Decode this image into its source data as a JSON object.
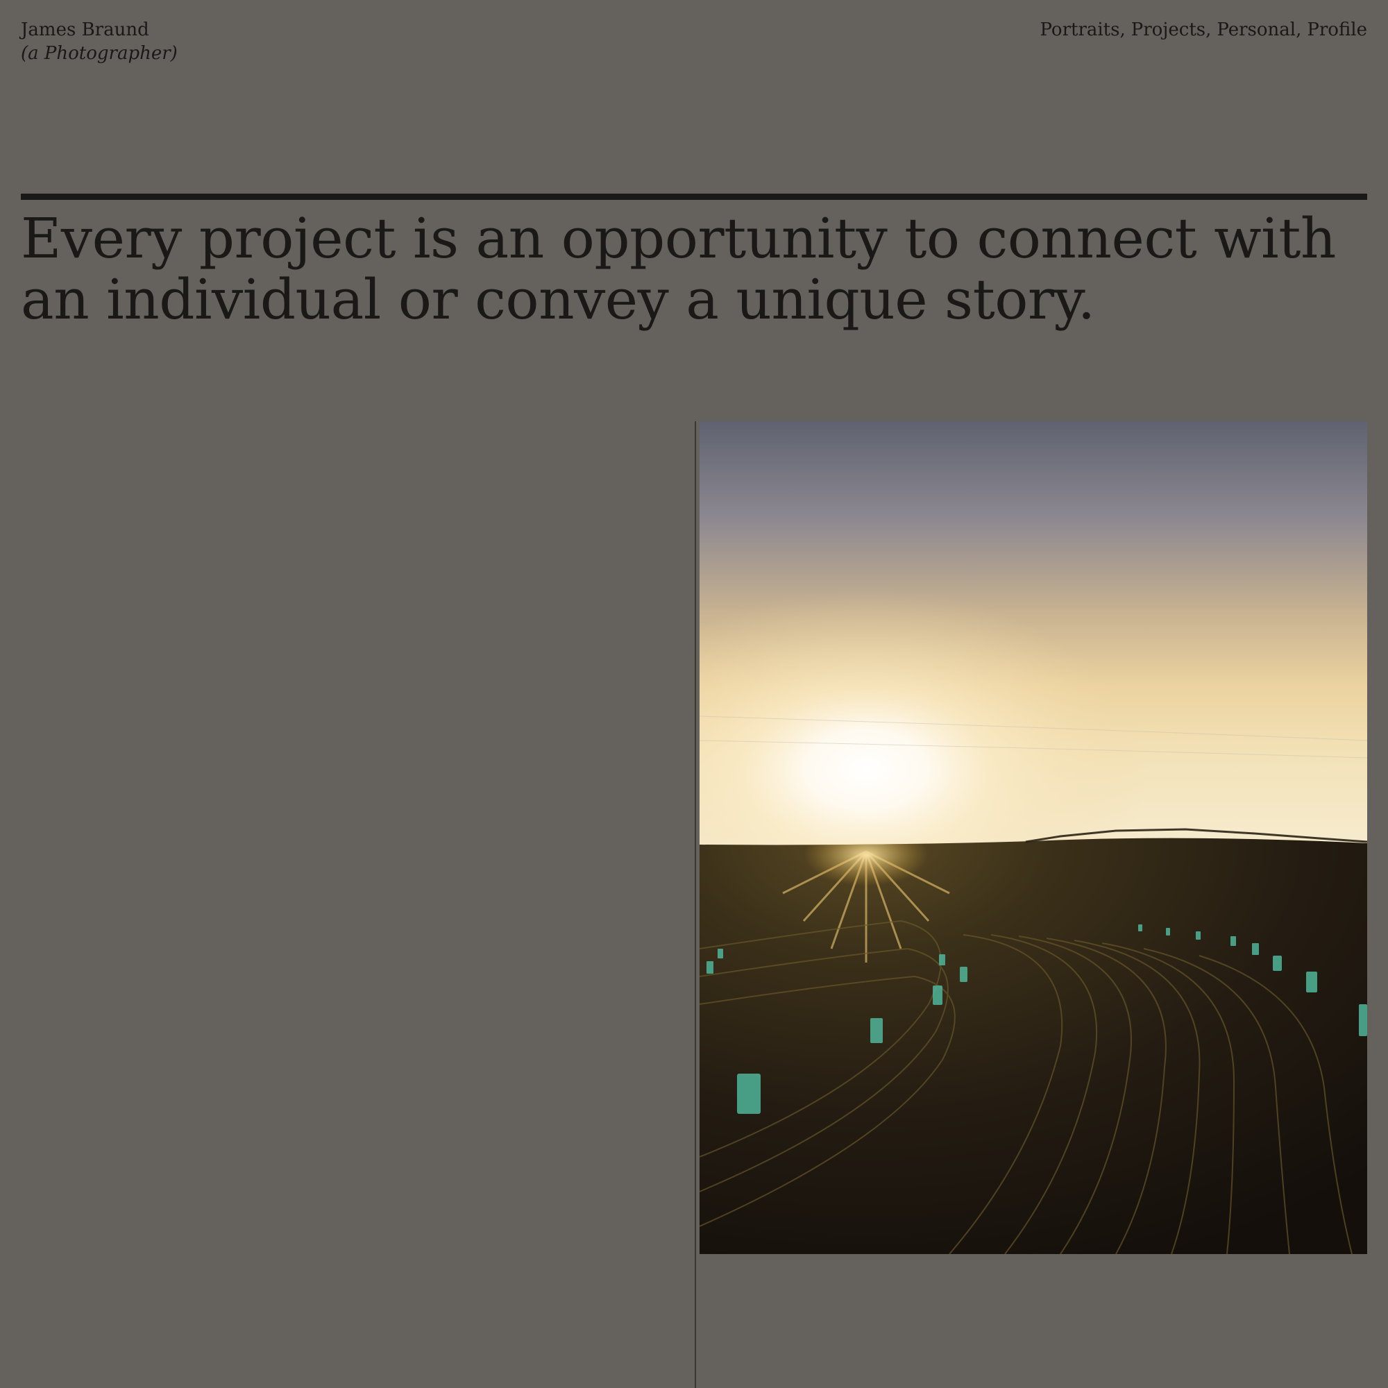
{
  "brand": {
    "name": "James Braund",
    "tagline": "(a Photographer)"
  },
  "nav": {
    "items": [
      "Portraits",
      "Projects",
      "Personal",
      "Profile"
    ],
    "separator": ","
  },
  "hero": {
    "headline_line1": "Every project is an opportunity to connect with",
    "headline_line2": "an individual or convey a unique story."
  },
  "colors": {
    "background": "#65615d",
    "text": "#1b1918"
  },
  "image": {
    "subject": "sunrise over a furrowed farm field with tree guards"
  }
}
